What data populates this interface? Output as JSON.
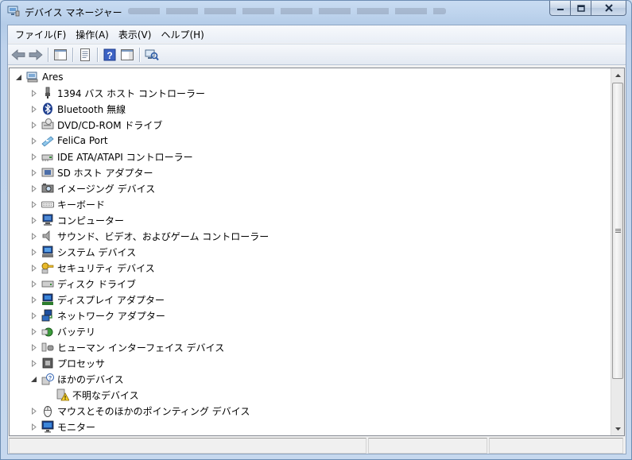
{
  "window": {
    "title": "デバイス マネージャー"
  },
  "menu": [
    "ファイル(F)",
    "操作(A)",
    "表示(V)",
    "ヘルプ(H)"
  ],
  "toolbar": [
    {
      "name": "back-button",
      "icon": "arrow-left-icon"
    },
    {
      "name": "forward-button",
      "icon": "arrow-right-icon"
    },
    {
      "name": "show-hide-console-tree-button",
      "icon": "console-tree-icon"
    },
    {
      "name": "properties-button",
      "icon": "properties-icon"
    },
    {
      "name": "help-button",
      "icon": "help-icon"
    },
    {
      "name": "action-pane-button",
      "icon": "action-pane-icon"
    },
    {
      "name": "scan-hardware-button",
      "icon": "scan-hardware-icon"
    }
  ],
  "tree": {
    "root": {
      "label": "Ares",
      "icon": "computer-root-icon",
      "expanded": true
    },
    "items": [
      {
        "label": "1394 バス ホスト コントローラー",
        "icon": "usb-plug-icon",
        "level": 1,
        "expanded": false
      },
      {
        "label": "Bluetooth 無線",
        "icon": "bluetooth-icon",
        "level": 1,
        "expanded": false
      },
      {
        "label": "DVD/CD-ROM ドライブ",
        "icon": "dvd-drive-icon",
        "level": 1,
        "expanded": false
      },
      {
        "label": "FeliCa Port",
        "icon": "felica-icon",
        "level": 1,
        "expanded": false
      },
      {
        "label": "IDE ATA/ATAPI コントローラー",
        "icon": "ide-controller-icon",
        "level": 1,
        "expanded": false
      },
      {
        "label": "SD ホスト アダプター",
        "icon": "sd-host-icon",
        "level": 1,
        "expanded": false
      },
      {
        "label": "イメージング デバイス",
        "icon": "imaging-device-icon",
        "level": 1,
        "expanded": false
      },
      {
        "label": "キーボード",
        "icon": "keyboard-icon",
        "level": 1,
        "expanded": false
      },
      {
        "label": "コンピューター",
        "icon": "computer-icon",
        "level": 1,
        "expanded": false
      },
      {
        "label": "サウンド、ビデオ、およびゲーム コントローラー",
        "icon": "speaker-icon",
        "level": 1,
        "expanded": false
      },
      {
        "label": "システム デバイス",
        "icon": "system-device-icon",
        "level": 1,
        "expanded": false
      },
      {
        "label": "セキュリティ デバイス",
        "icon": "security-key-icon",
        "level": 1,
        "expanded": false
      },
      {
        "label": "ディスク ドライブ",
        "icon": "disk-drive-icon",
        "level": 1,
        "expanded": false
      },
      {
        "label": "ディスプレイ アダプター",
        "icon": "display-adapter-icon",
        "level": 1,
        "expanded": false
      },
      {
        "label": "ネットワーク アダプター",
        "icon": "network-adapter-icon",
        "level": 1,
        "expanded": false
      },
      {
        "label": "バッテリ",
        "icon": "battery-icon",
        "level": 1,
        "expanded": false
      },
      {
        "label": "ヒューマン インターフェイス デバイス",
        "icon": "hid-icon",
        "level": 1,
        "expanded": false
      },
      {
        "label": "プロセッサ",
        "icon": "processor-icon",
        "level": 1,
        "expanded": false
      },
      {
        "label": "ほかのデバイス",
        "icon": "other-devices-icon",
        "level": 1,
        "expanded": true
      },
      {
        "label": "不明なデバイス",
        "icon": "unknown-device-warning-icon",
        "level": 2,
        "expanded": null
      },
      {
        "label": "マウスとそのほかのポインティング デバイス",
        "icon": "mouse-icon",
        "level": 1,
        "expanded": false
      },
      {
        "label": "モニター",
        "icon": "monitor-icon",
        "level": 1,
        "expanded": false
      }
    ]
  },
  "colors": {
    "title_bar": "#c3d6ee",
    "tree_background": "#ffffff",
    "client": "#f0f0f0"
  }
}
